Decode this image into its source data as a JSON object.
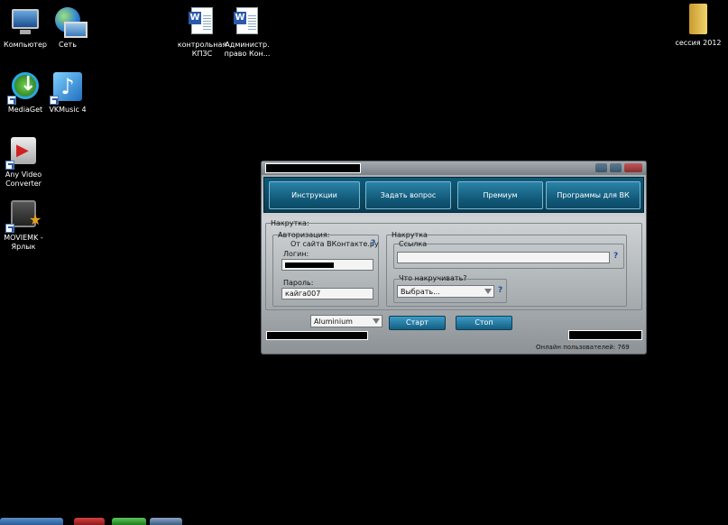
{
  "desktop": {
    "icons": [
      {
        "label": "Компьютер",
        "icon": "computer-icon"
      },
      {
        "label": "Сеть",
        "icon": "network-icon"
      },
      {
        "label": "MediaGet",
        "icon": "mediaget-icon"
      },
      {
        "label": "VKMusic 4",
        "icon": "vkmusic-icon"
      },
      {
        "label": "Any Video Converter",
        "icon": "any-video-converter-icon"
      },
      {
        "label": "MOVIEMK - Ярлык",
        "icon": "moviemk-icon"
      },
      {
        "label": "контрольная КПЗС",
        "icon": "word-document-icon"
      },
      {
        "label": "Администр. право Кон...",
        "icon": "word-document-icon"
      },
      {
        "label": "сессия 2012",
        "icon": "folder-icon"
      }
    ]
  },
  "app": {
    "tabs": [
      "Инструкции",
      "Задать вопрос",
      "Премиум",
      "Программы для ВК"
    ],
    "section_title": "Накрутка:",
    "auth": {
      "title": "Авторизация:",
      "from_site": "От сайта ВКонтакте.ру",
      "help": "?",
      "login_label": "Логин:",
      "password_label": "Пароль:",
      "password_value": "кайга007"
    },
    "boost": {
      "title": "Накрутка",
      "link_label": "Ссылка",
      "link_value": "",
      "help": "?",
      "what_label": "Что накручивать?",
      "what_selected": "Выбрать..."
    },
    "skin_selected": "Aluminium",
    "start_label": "Старт",
    "stop_label": "Стоп",
    "online_users": "Онлайн пользователей: 769"
  },
  "colors": {
    "tab_bar": "#0f5a78",
    "button": "#2b84a8",
    "window_body": "#b4b9bc"
  }
}
